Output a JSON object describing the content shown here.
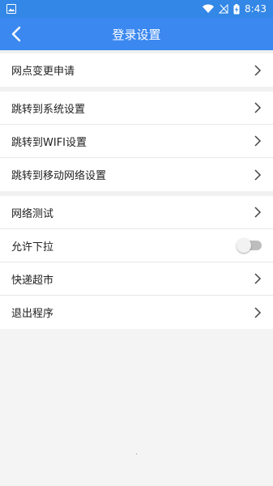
{
  "status_bar": {
    "time": "8:43",
    "icons": [
      "image-icon",
      "wifi-icon",
      "no-signal-icon",
      "battery-charging-icon"
    ]
  },
  "app_bar": {
    "title": "登录设置",
    "back_icon": "chevron-left-icon"
  },
  "groups": [
    {
      "items": [
        {
          "label": "网点变更申请",
          "type": "link"
        }
      ]
    },
    {
      "items": [
        {
          "label": "跳转到系统设置",
          "type": "link"
        },
        {
          "label": "跳转到WIFI设置",
          "type": "link"
        },
        {
          "label": "跳转到移动网络设置",
          "type": "link"
        }
      ]
    },
    {
      "items": [
        {
          "label": "网络测试",
          "type": "link"
        },
        {
          "label": "允许下拉",
          "type": "toggle",
          "value": false
        },
        {
          "label": "快递超市",
          "type": "link"
        },
        {
          "label": "退出程序",
          "type": "link"
        }
      ]
    }
  ],
  "colors": {
    "primary": "#3b88f0",
    "status_bar": "#3387e6",
    "background": "#f4f4f4"
  }
}
